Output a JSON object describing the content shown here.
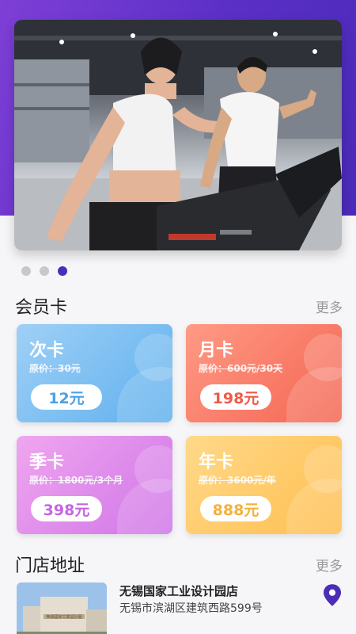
{
  "banner": {
    "alt": "健身房跑步机"
  },
  "carousel": {
    "count": 3,
    "active_index": 2
  },
  "membership": {
    "title": "会员卡",
    "more": "更多",
    "cards": [
      {
        "name": "次卡",
        "original": "原价：30元",
        "price": "12元"
      },
      {
        "name": "月卡",
        "original": "原价：600元/30天",
        "price": "198元"
      },
      {
        "name": "季卡",
        "original": "原价：1800元/3个月",
        "price": "398元"
      },
      {
        "name": "年卡",
        "original": "原价：3600元/年",
        "price": "888元"
      }
    ]
  },
  "stores": {
    "title": "门店地址",
    "more": "更多",
    "items": [
      {
        "name": "无锡国家工业设计园店",
        "address": "无锡市滨湖区建筑西路599号",
        "sign": "無錫國家工業設計園"
      }
    ]
  },
  "colors": {
    "accent": "#4b2db7",
    "header_gradient": [
      "#7e3fd6",
      "#4a2ab8"
    ]
  }
}
